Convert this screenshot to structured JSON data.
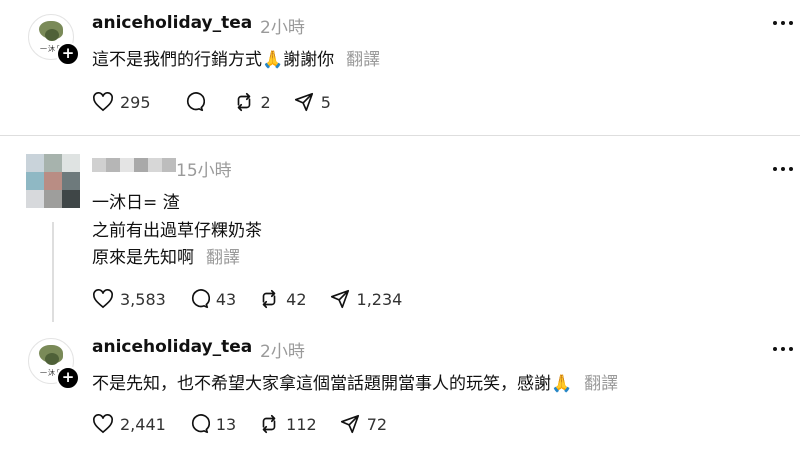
{
  "posts": [
    {
      "user": "aniceholiday_tea",
      "time": "2小時",
      "lines": [
        "這不是我們的行銷方式🙏謝謝你"
      ],
      "translate": "翻譯",
      "likes": "295",
      "comments": "",
      "reposts": "2",
      "shares": "5"
    },
    {
      "user": "",
      "time": "15小時",
      "lines": [
        "一沐日= 渣",
        "之前有出過草仔粿奶茶",
        "原來是先知啊"
      ],
      "translate": "翻譯",
      "likes": "3,583",
      "comments": "43",
      "reposts": "42",
      "shares": "1,234"
    },
    {
      "user": "aniceholiday_tea",
      "time": "2小時",
      "lines": [
        "不是先知，也不希望大家拿這個當話題開當事人的玩笑，感謝🙏"
      ],
      "translate": "翻譯",
      "likes": "2,441",
      "comments": "13",
      "reposts": "112",
      "shares": "72"
    }
  ],
  "avatar_text": "一沐日",
  "icons": [
    "heart-icon",
    "comment-icon",
    "repost-icon",
    "share-icon",
    "more-icon",
    "follow-plus-icon"
  ],
  "colors": {
    "text": "#111111",
    "muted": "#9a9a9a",
    "divider": "#dedede"
  }
}
